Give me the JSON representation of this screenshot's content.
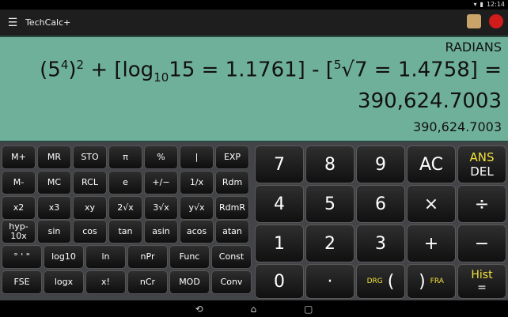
{
  "status": {
    "time": "12:14"
  },
  "toolbar": {
    "title": "TechCalc+",
    "menu_icon": "menu-icon"
  },
  "display": {
    "mode": "RADIANS",
    "expr_part1": "(5",
    "expr_sup1": "4",
    "expr_part2": ")",
    "expr_sup2": "2",
    "expr_part3": " + [log",
    "expr_sub3": "10",
    "expr_part4": "15 = 1.1761] - [",
    "expr_sup4": "5",
    "expr_part5": "√7 = 1.4758] =",
    "result": "390,624.7003",
    "answer": "390,624.7003"
  },
  "sci_keys": [
    [
      "M+",
      "MR",
      "STO",
      "π",
      "%",
      "|",
      "EXP"
    ],
    [
      "M-",
      "MC",
      "RCL",
      "e",
      "+/−",
      "1/x",
      "Rdm"
    ],
    [
      "x2",
      "x3",
      "xy",
      "2√x",
      "3√x",
      "y√x",
      "RdmR"
    ],
    [
      "hyp-10x",
      "sin",
      "cos",
      "tan",
      "asin",
      "acos",
      "atan"
    ],
    [
      "° ' \"",
      "log10",
      "ln",
      "nPr",
      "Func",
      "Const"
    ],
    [
      "FSE",
      "logx",
      "x!",
      "nCr",
      "MOD",
      "Conv"
    ]
  ],
  "num_keys": {
    "row1": [
      "7",
      "8",
      "9",
      "AC"
    ],
    "ans": "ANS",
    "del": "DEL",
    "row2": [
      "4",
      "5",
      "6",
      "×",
      "÷"
    ],
    "row3": [
      "1",
      "2",
      "3",
      "+",
      "−"
    ],
    "zero": "0",
    "dot": "·",
    "drg": "DRG",
    "open": "(",
    "close": ")",
    "fra": "FRA",
    "hist": "Hist",
    "eq": "="
  }
}
